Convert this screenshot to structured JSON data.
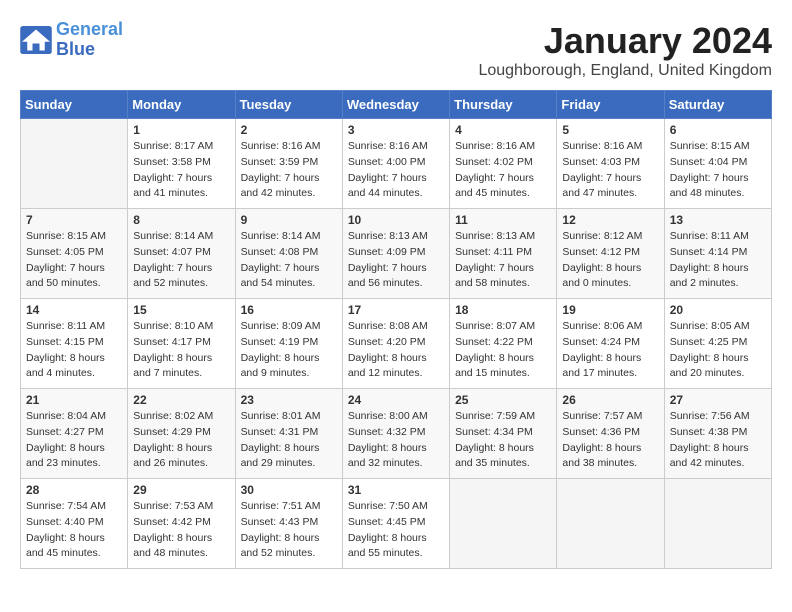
{
  "logo": {
    "line1": "General",
    "line2": "Blue"
  },
  "title": "January 2024",
  "location": "Loughborough, England, United Kingdom",
  "weekdays": [
    "Sunday",
    "Monday",
    "Tuesday",
    "Wednesday",
    "Thursday",
    "Friday",
    "Saturday"
  ],
  "weeks": [
    [
      {
        "day": "",
        "sunrise": "",
        "sunset": "",
        "daylight": ""
      },
      {
        "day": "1",
        "sunrise": "Sunrise: 8:17 AM",
        "sunset": "Sunset: 3:58 PM",
        "daylight": "Daylight: 7 hours and 41 minutes."
      },
      {
        "day": "2",
        "sunrise": "Sunrise: 8:16 AM",
        "sunset": "Sunset: 3:59 PM",
        "daylight": "Daylight: 7 hours and 42 minutes."
      },
      {
        "day": "3",
        "sunrise": "Sunrise: 8:16 AM",
        "sunset": "Sunset: 4:00 PM",
        "daylight": "Daylight: 7 hours and 44 minutes."
      },
      {
        "day": "4",
        "sunrise": "Sunrise: 8:16 AM",
        "sunset": "Sunset: 4:02 PM",
        "daylight": "Daylight: 7 hours and 45 minutes."
      },
      {
        "day": "5",
        "sunrise": "Sunrise: 8:16 AM",
        "sunset": "Sunset: 4:03 PM",
        "daylight": "Daylight: 7 hours and 47 minutes."
      },
      {
        "day": "6",
        "sunrise": "Sunrise: 8:15 AM",
        "sunset": "Sunset: 4:04 PM",
        "daylight": "Daylight: 7 hours and 48 minutes."
      }
    ],
    [
      {
        "day": "7",
        "sunrise": "Sunrise: 8:15 AM",
        "sunset": "Sunset: 4:05 PM",
        "daylight": "Daylight: 7 hours and 50 minutes."
      },
      {
        "day": "8",
        "sunrise": "Sunrise: 8:14 AM",
        "sunset": "Sunset: 4:07 PM",
        "daylight": "Daylight: 7 hours and 52 minutes."
      },
      {
        "day": "9",
        "sunrise": "Sunrise: 8:14 AM",
        "sunset": "Sunset: 4:08 PM",
        "daylight": "Daylight: 7 hours and 54 minutes."
      },
      {
        "day": "10",
        "sunrise": "Sunrise: 8:13 AM",
        "sunset": "Sunset: 4:09 PM",
        "daylight": "Daylight: 7 hours and 56 minutes."
      },
      {
        "day": "11",
        "sunrise": "Sunrise: 8:13 AM",
        "sunset": "Sunset: 4:11 PM",
        "daylight": "Daylight: 7 hours and 58 minutes."
      },
      {
        "day": "12",
        "sunrise": "Sunrise: 8:12 AM",
        "sunset": "Sunset: 4:12 PM",
        "daylight": "Daylight: 8 hours and 0 minutes."
      },
      {
        "day": "13",
        "sunrise": "Sunrise: 8:11 AM",
        "sunset": "Sunset: 4:14 PM",
        "daylight": "Daylight: 8 hours and 2 minutes."
      }
    ],
    [
      {
        "day": "14",
        "sunrise": "Sunrise: 8:11 AM",
        "sunset": "Sunset: 4:15 PM",
        "daylight": "Daylight: 8 hours and 4 minutes."
      },
      {
        "day": "15",
        "sunrise": "Sunrise: 8:10 AM",
        "sunset": "Sunset: 4:17 PM",
        "daylight": "Daylight: 8 hours and 7 minutes."
      },
      {
        "day": "16",
        "sunrise": "Sunrise: 8:09 AM",
        "sunset": "Sunset: 4:19 PM",
        "daylight": "Daylight: 8 hours and 9 minutes."
      },
      {
        "day": "17",
        "sunrise": "Sunrise: 8:08 AM",
        "sunset": "Sunset: 4:20 PM",
        "daylight": "Daylight: 8 hours and 12 minutes."
      },
      {
        "day": "18",
        "sunrise": "Sunrise: 8:07 AM",
        "sunset": "Sunset: 4:22 PM",
        "daylight": "Daylight: 8 hours and 15 minutes."
      },
      {
        "day": "19",
        "sunrise": "Sunrise: 8:06 AM",
        "sunset": "Sunset: 4:24 PM",
        "daylight": "Daylight: 8 hours and 17 minutes."
      },
      {
        "day": "20",
        "sunrise": "Sunrise: 8:05 AM",
        "sunset": "Sunset: 4:25 PM",
        "daylight": "Daylight: 8 hours and 20 minutes."
      }
    ],
    [
      {
        "day": "21",
        "sunrise": "Sunrise: 8:04 AM",
        "sunset": "Sunset: 4:27 PM",
        "daylight": "Daylight: 8 hours and 23 minutes."
      },
      {
        "day": "22",
        "sunrise": "Sunrise: 8:02 AM",
        "sunset": "Sunset: 4:29 PM",
        "daylight": "Daylight: 8 hours and 26 minutes."
      },
      {
        "day": "23",
        "sunrise": "Sunrise: 8:01 AM",
        "sunset": "Sunset: 4:31 PM",
        "daylight": "Daylight: 8 hours and 29 minutes."
      },
      {
        "day": "24",
        "sunrise": "Sunrise: 8:00 AM",
        "sunset": "Sunset: 4:32 PM",
        "daylight": "Daylight: 8 hours and 32 minutes."
      },
      {
        "day": "25",
        "sunrise": "Sunrise: 7:59 AM",
        "sunset": "Sunset: 4:34 PM",
        "daylight": "Daylight: 8 hours and 35 minutes."
      },
      {
        "day": "26",
        "sunrise": "Sunrise: 7:57 AM",
        "sunset": "Sunset: 4:36 PM",
        "daylight": "Daylight: 8 hours and 38 minutes."
      },
      {
        "day": "27",
        "sunrise": "Sunrise: 7:56 AM",
        "sunset": "Sunset: 4:38 PM",
        "daylight": "Daylight: 8 hours and 42 minutes."
      }
    ],
    [
      {
        "day": "28",
        "sunrise": "Sunrise: 7:54 AM",
        "sunset": "Sunset: 4:40 PM",
        "daylight": "Daylight: 8 hours and 45 minutes."
      },
      {
        "day": "29",
        "sunrise": "Sunrise: 7:53 AM",
        "sunset": "Sunset: 4:42 PM",
        "daylight": "Daylight: 8 hours and 48 minutes."
      },
      {
        "day": "30",
        "sunrise": "Sunrise: 7:51 AM",
        "sunset": "Sunset: 4:43 PM",
        "daylight": "Daylight: 8 hours and 52 minutes."
      },
      {
        "day": "31",
        "sunrise": "Sunrise: 7:50 AM",
        "sunset": "Sunset: 4:45 PM",
        "daylight": "Daylight: 8 hours and 55 minutes."
      },
      {
        "day": "",
        "sunrise": "",
        "sunset": "",
        "daylight": ""
      },
      {
        "day": "",
        "sunrise": "",
        "sunset": "",
        "daylight": ""
      },
      {
        "day": "",
        "sunrise": "",
        "sunset": "",
        "daylight": ""
      }
    ]
  ]
}
